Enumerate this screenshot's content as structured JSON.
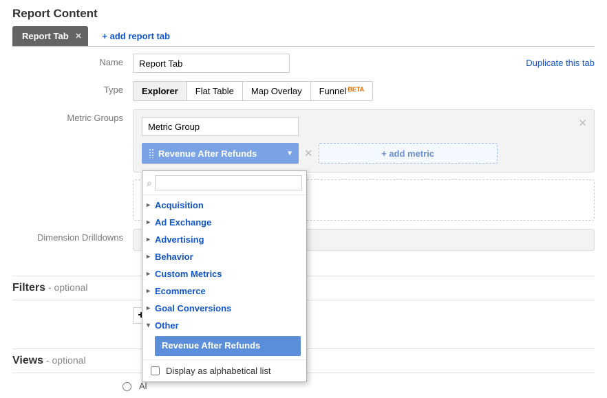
{
  "header": {
    "title": "Report Content"
  },
  "tabs": {
    "current": "Report Tab",
    "add_label": "+ add report tab"
  },
  "labels": {
    "name": "Name",
    "type": "Type",
    "metric_groups": "Metric Groups",
    "dimension_drilldowns": "Dimension Drilldowns",
    "duplicate": "Duplicate this tab"
  },
  "name_field": {
    "value": "Report Tab"
  },
  "type_toggle": {
    "options": [
      {
        "label": "Explorer",
        "active": true
      },
      {
        "label": "Flat Table",
        "active": false
      },
      {
        "label": "Map Overlay",
        "active": false
      },
      {
        "label": "Funnel",
        "badge": "BETA",
        "active": false
      }
    ]
  },
  "metric_group": {
    "name_value": "Metric Group",
    "chip_label": "Revenue After Refunds",
    "add_metric_label": "+ add metric"
  },
  "dropdown": {
    "categories": [
      "Acquisition",
      "Ad Exchange",
      "Advertising",
      "Behavior",
      "Custom Metrics",
      "Ecommerce",
      "Goal Conversions"
    ],
    "open_category": "Other",
    "open_items": [
      "Revenue After Refunds"
    ],
    "alpha_label": "Display as alphabetical list"
  },
  "sections": {
    "filters_strong": "Filters",
    "views_strong": "Views",
    "optional": " - optional"
  },
  "views": {
    "radio_label_partial": "Al"
  }
}
